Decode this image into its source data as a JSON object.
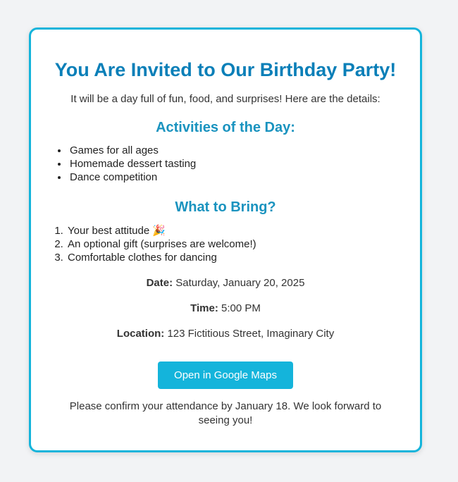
{
  "invite": {
    "title": "You Are Invited to Our Birthday Party!",
    "intro": "It will be a day full of fun, food, and surprises! Here are the details:",
    "activities_heading": "Activities of the Day:",
    "activities": [
      "Games for all ages",
      "Homemade dessert tasting",
      "Dance competition"
    ],
    "bring_heading": "What to Bring?",
    "bring_items": [
      "Your best attitude 🎉",
      "An optional gift (surprises are welcome!)",
      "Comfortable clothes for dancing"
    ],
    "date_label": "Date:",
    "date_value": "Saturday, January 20, 2025",
    "time_label": "Time:",
    "time_value": "5:00 PM",
    "location_label": "Location:",
    "location_value": "123 Fictitious Street, Imaginary City",
    "map_button_label": "Open in Google Maps",
    "closing": "Please confirm your attendance by January 18. We look forward to seeing you!"
  },
  "colors": {
    "accent": "#14b4db",
    "title": "#0a7fb8",
    "subheading": "#1a93bf",
    "background": "#f2f3f5"
  }
}
